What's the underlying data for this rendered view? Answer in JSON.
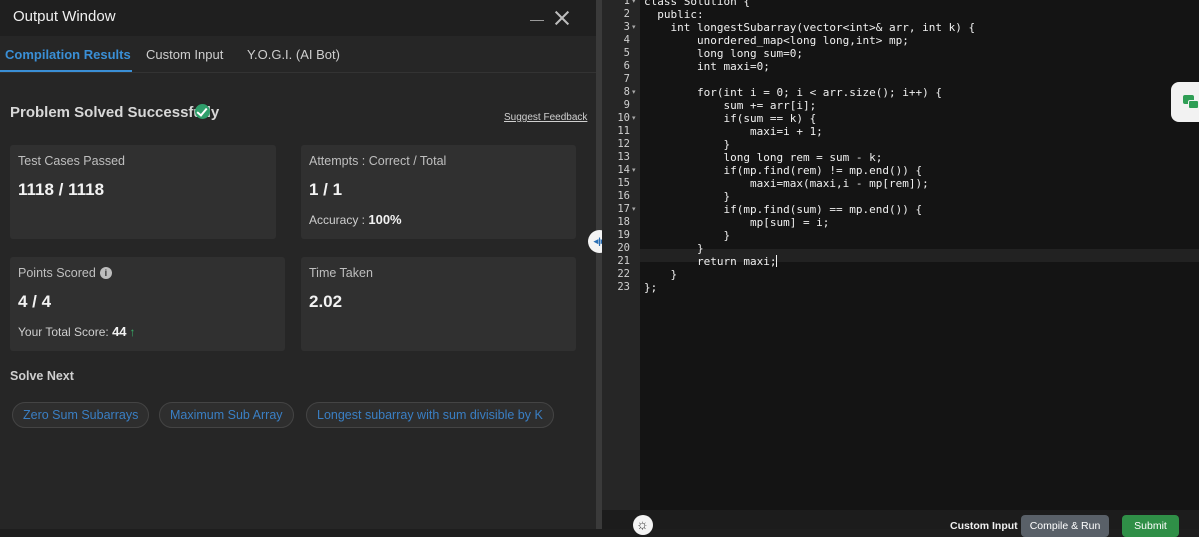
{
  "output_window": {
    "title": "Output Window",
    "tabs": [
      {
        "label": "Compilation Results",
        "active": true
      },
      {
        "label": "Custom Input",
        "active": false
      },
      {
        "label": "Y.O.G.I. (AI Bot)",
        "active": false
      }
    ],
    "status_heading": "Problem Solved Successfully",
    "status_icon": "check-circle-icon",
    "suggest_feedback": "Suggest Feedback",
    "cards": {
      "test_cases": {
        "label": "Test Cases Passed",
        "value": "1118 / 1118"
      },
      "attempts": {
        "label": "Attempts : Correct / Total",
        "value": "1 / 1",
        "accuracy_label": "Accuracy :",
        "accuracy_value": "100%"
      },
      "points": {
        "label": "Points Scored",
        "value": "4 / 4",
        "total_label": "Your Total Score:",
        "total_value": "44",
        "trend_icon": "arrow-up-icon"
      },
      "time": {
        "label": "Time Taken",
        "value": "2.02"
      }
    },
    "solve_next_heading": "Solve Next",
    "solve_next": [
      "Zero Sum Subarrays",
      "Maximum Sub Array",
      "Longest subarray with sum divisible by K"
    ]
  },
  "editor": {
    "line_numbers": [
      "1",
      "2",
      "3",
      "4",
      "5",
      "6",
      "7",
      "8",
      "9",
      "10",
      "11",
      "12",
      "13",
      "14",
      "15",
      "16",
      "17",
      "18",
      "19",
      "20",
      "21",
      "22",
      "23"
    ],
    "fold_lines": [
      1,
      3,
      8,
      10,
      14,
      17
    ],
    "code_lines": [
      "class Solution {",
      "  public:",
      "    int longestSubarray(vector<int>& arr, int k) {",
      "        unordered_map<long long,int> mp;",
      "        long long sum=0;",
      "        int maxi=0;",
      "",
      "        for(int i = 0; i < arr.size(); i++) {",
      "            sum += arr[i];",
      "            if(sum == k) {",
      "                maxi=i + 1;",
      "            }",
      "            long long rem = sum - k;",
      "            if(mp.find(rem) != mp.end()) {",
      "                maxi=max(maxi,i - mp[rem]);",
      "            }",
      "            if(mp.find(sum) == mp.end()) {",
      "                mp[sum] = i;",
      "            }",
      "        }",
      "        return maxi;",
      "    }",
      "};"
    ],
    "cursor_line": 21
  },
  "bottom_bar": {
    "custom_input": "Custom Input",
    "compile_run": "Compile & Run",
    "submit": "Submit"
  }
}
